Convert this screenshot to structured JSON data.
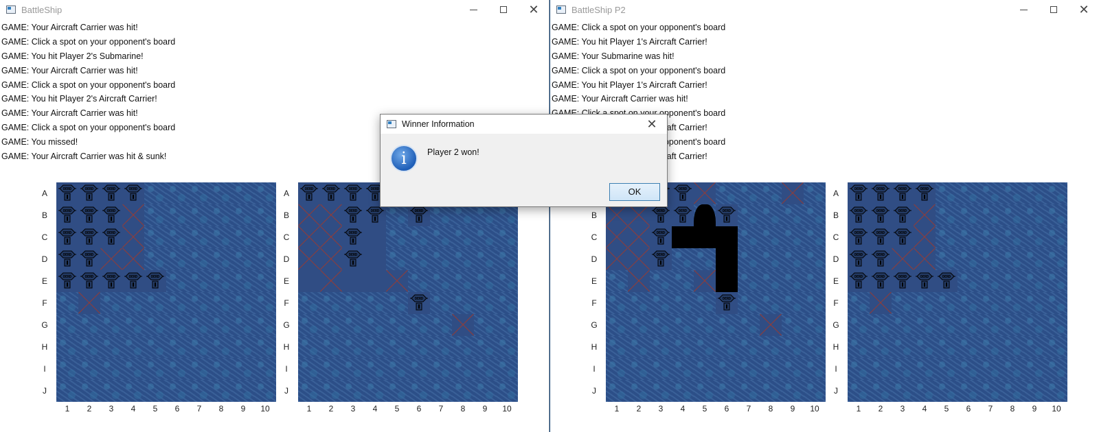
{
  "window1": {
    "title": "BattleShip",
    "log": [
      "GAME: Your Aircraft Carrier was hit!",
      "GAME: Click a spot on your opponent's board",
      "GAME: You hit Player 2's Submarine!",
      "GAME: Your Aircraft Carrier was hit!",
      "GAME: Click a spot on your opponent's board",
      "GAME: You hit Player 2's Aircraft Carrier!",
      "GAME: Your Aircraft Carrier was hit!",
      "GAME: Click a spot on your opponent's board",
      "GAME: You missed!",
      "GAME: Your Aircraft Carrier was hit & sunk!"
    ],
    "boards": [
      {
        "ships": [
          "A1",
          "A2",
          "A3",
          "A4",
          "B1",
          "B2",
          "B3",
          "C1",
          "C2",
          "C3",
          "D1",
          "D2",
          "E1",
          "E2",
          "E3",
          "E4",
          "E5"
        ],
        "misses": [
          "B4",
          "C4",
          "D3",
          "D4",
          "F2"
        ],
        "tinted": [
          "A1",
          "A2",
          "A3",
          "A4",
          "B1",
          "B2",
          "B3",
          "B4",
          "C1",
          "C2",
          "C3",
          "C4",
          "D1",
          "D2",
          "D3",
          "D4",
          "E1",
          "E2",
          "E3",
          "E4",
          "E5",
          "F2"
        ]
      },
      {
        "ships": [
          "A1",
          "A2",
          "A3",
          "A4",
          "B3",
          "B4",
          "B6",
          "C3",
          "D3",
          "F6"
        ],
        "misses": [
          "B1",
          "B2",
          "C1",
          "C2",
          "D1",
          "D2",
          "E2",
          "E5",
          "G8"
        ],
        "tinted": [
          "A1",
          "A2",
          "A3",
          "A4",
          "B1",
          "B2",
          "B3",
          "B4",
          "B6",
          "C1",
          "C2",
          "C3",
          "C4",
          "D1",
          "D2",
          "D3",
          "D4",
          "E1",
          "E2",
          "E3",
          "E4",
          "E5",
          "F6",
          "G8"
        ]
      }
    ]
  },
  "window2": {
    "title": "BattleShip P2",
    "log": [
      "GAME: Click a spot on your opponent's board",
      "GAME: You hit Player 1's Aircraft Carrier!",
      "GAME: Your Submarine was hit!",
      "GAME: Click a spot on your opponent's board",
      "GAME: You hit Player 1's Aircraft Carrier!",
      "GAME: Your Aircraft Carrier was hit!",
      "GAME: Click a spot on your opponent's board",
      "GAME: You hit Player 1's Aircraft Carrier!",
      "GAME: Click a spot on your opponent's board",
      "GAME: You hit Player 1's Aircraft Carrier!"
    ],
    "boards": [
      {
        "ships": [
          "A3",
          "A4",
          "B3",
          "B4",
          "B6",
          "C3",
          "D3",
          "F6"
        ],
        "misses": [
          "A5",
          "A9",
          "B1",
          "B2",
          "C1",
          "C2",
          "D1",
          "D2",
          "E2",
          "E5",
          "G8"
        ],
        "tinted": [
          "A3",
          "A4",
          "A5",
          "A9",
          "B1",
          "B2",
          "B3",
          "B4",
          "B6",
          "C1",
          "C2",
          "C3",
          "D1",
          "D2",
          "D3",
          "E2",
          "E5",
          "F6",
          "G8"
        ]
      },
      {
        "ships": [
          "A1",
          "A2",
          "A3",
          "A4",
          "B1",
          "B2",
          "B3",
          "C1",
          "C2",
          "C3",
          "D1",
          "D2",
          "E1",
          "E2",
          "E3",
          "E4",
          "E5"
        ],
        "misses": [
          "B4",
          "C4",
          "D3",
          "D4",
          "F2"
        ],
        "tinted": [
          "A1",
          "A2",
          "A3",
          "A4",
          "B1",
          "B2",
          "B3",
          "B4",
          "C1",
          "C2",
          "C3",
          "C4",
          "D1",
          "D2",
          "D3",
          "D4",
          "E1",
          "E2",
          "E3",
          "E4",
          "E5",
          "F2"
        ]
      }
    ]
  },
  "rows": [
    "A",
    "B",
    "C",
    "D",
    "E",
    "F",
    "G",
    "H",
    "I",
    "J"
  ],
  "cols": [
    "1",
    "2",
    "3",
    "4",
    "5",
    "6",
    "7",
    "8",
    "9",
    "10"
  ],
  "ship_text": "DERD",
  "dialog": {
    "title": "Winner Information",
    "message": "Player 2 won!",
    "ok_label": "OK",
    "icon": "info-icon"
  },
  "colors": {
    "water": "#2f528c",
    "miss": "#a33a2a",
    "accent": "#3c7fb1"
  }
}
